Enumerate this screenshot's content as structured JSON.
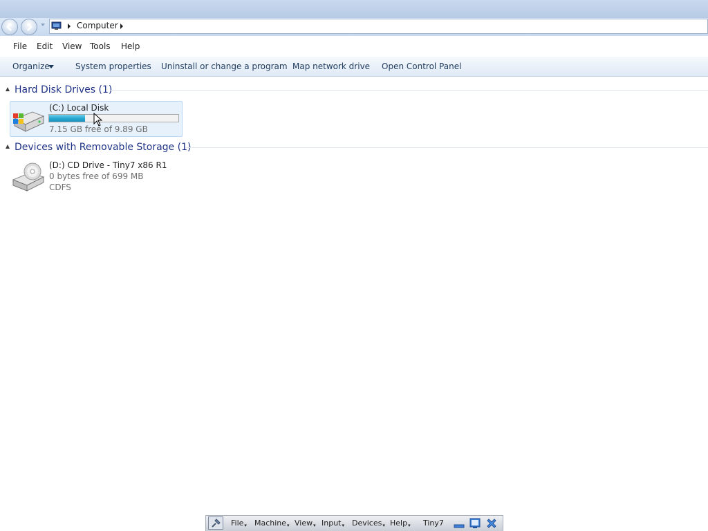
{
  "address_bar": {
    "crumb": "Computer"
  },
  "menu": {
    "file": "File",
    "edit": "Edit",
    "view": "View",
    "tools": "Tools",
    "help": "Help"
  },
  "command_bar": {
    "organize": "Organize",
    "system_properties": "System properties",
    "uninstall": "Uninstall or change a program",
    "map_drive": "Map network drive",
    "control_panel": "Open Control Panel"
  },
  "groups": [
    {
      "title": "Hard Disk Drives (1)",
      "items": [
        {
          "name": "(C:) Local Disk",
          "free_text": "7.15 GB free of 9.89 GB",
          "used_fraction": 0.277,
          "icon": "hard-disk-windows-icon"
        }
      ]
    },
    {
      "title": "Devices with Removable Storage (1)",
      "items": [
        {
          "name": "(D:) CD Drive - Tiny7 x86 R1",
          "free_text": "0 bytes free of 699 MB",
          "filesystem": "CDFS",
          "icon": "cd-drive-icon"
        }
      ]
    }
  ],
  "vbox_toolbar": {
    "menus": [
      "File",
      "Machine",
      "View",
      "Input",
      "Devices",
      "Help"
    ],
    "vm_name": "Tiny7"
  },
  "colors": {
    "group_title": "#1e3287",
    "usage_fill": "#25a6cf",
    "command_text": "#1e3a5c"
  }
}
